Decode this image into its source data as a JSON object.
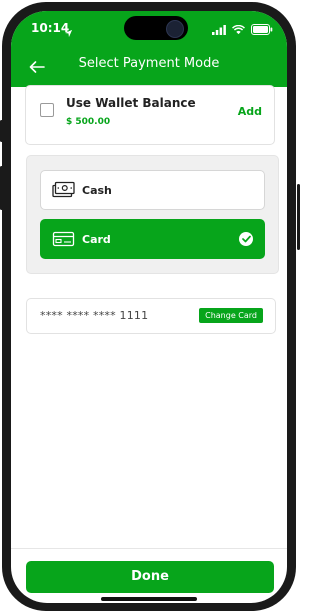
{
  "status_bar": {
    "time": "10:14",
    "icons": [
      "location-arrow-icon",
      "signal-bars-icon",
      "wifi-icon",
      "battery-icon"
    ]
  },
  "header": {
    "title": "Select Payment Mode",
    "back_icon": "arrow-left-icon"
  },
  "wallet": {
    "label": "Use Wallet Balance",
    "amount": "$ 500.00",
    "add_label": "Add",
    "checked": false
  },
  "payment_options": [
    {
      "label": "Cash",
      "icon": "cash-icon",
      "selected": false
    },
    {
      "label": "Card",
      "icon": "card-icon",
      "selected": true
    }
  ],
  "saved_card": {
    "number": "**** **** **** 1111",
    "change_label": "Change Card"
  },
  "footer": {
    "done_label": "Done"
  },
  "colors": {
    "accent": "#07a51b",
    "panel": "#f0f0f0",
    "text": "#222222"
  }
}
